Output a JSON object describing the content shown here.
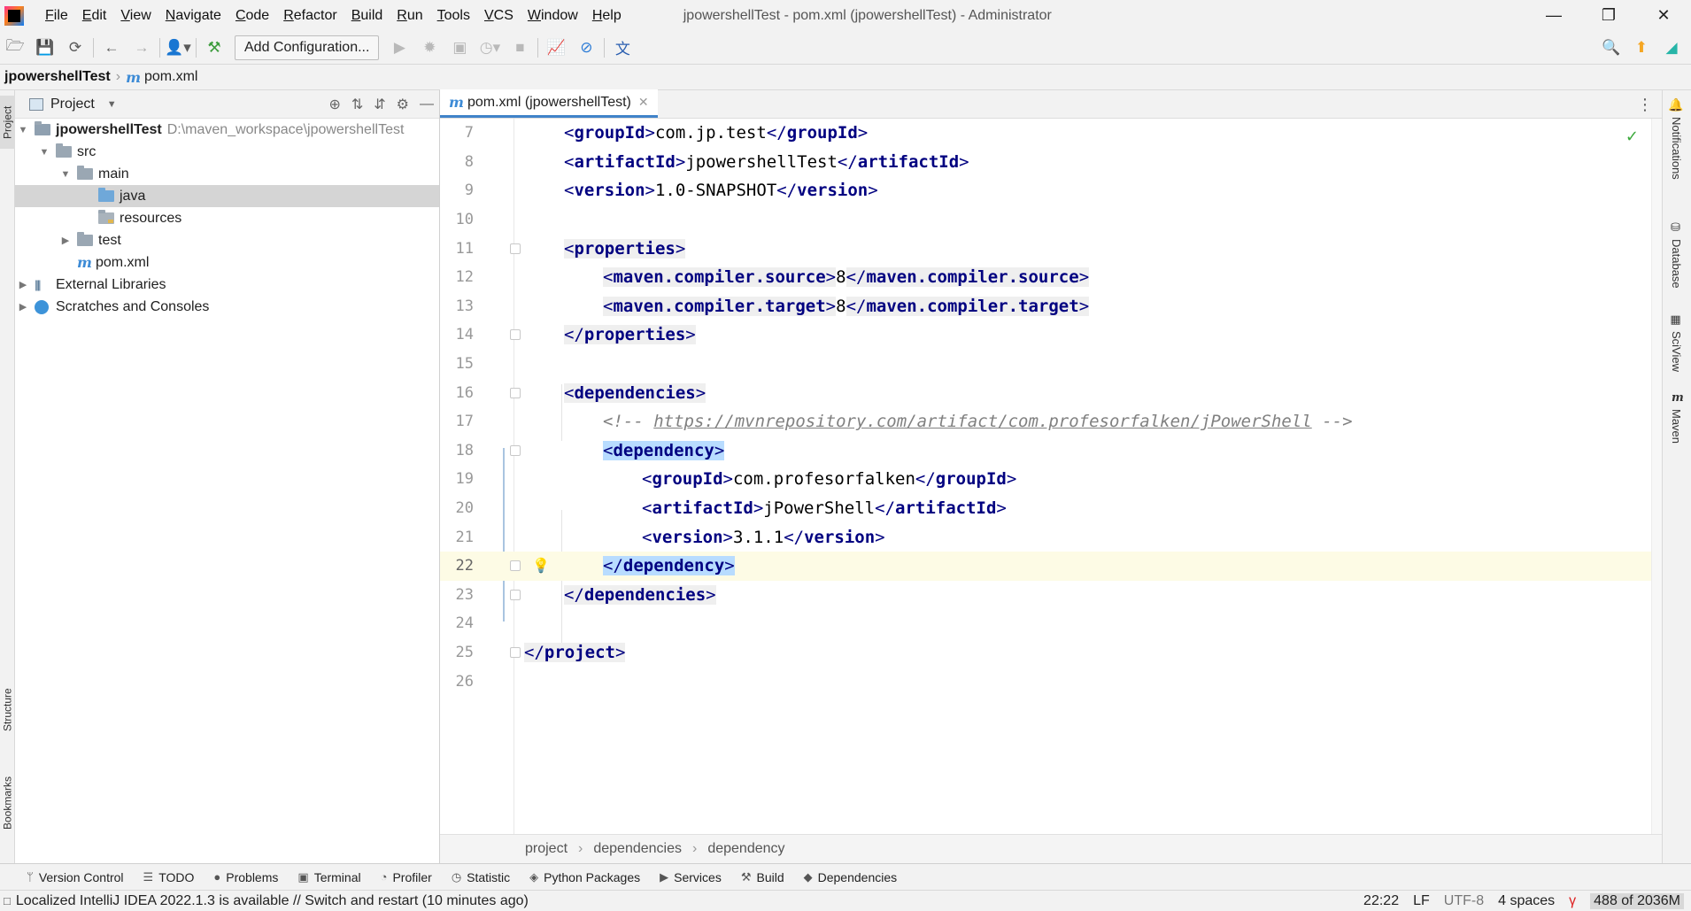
{
  "menu": {
    "items": [
      {
        "underline": "F",
        "rest": "ile"
      },
      {
        "underline": "E",
        "rest": "dit"
      },
      {
        "underline": "V",
        "rest": "iew"
      },
      {
        "underline": "N",
        "rest": "avigate"
      },
      {
        "underline": "C",
        "rest": "ode"
      },
      {
        "underline": "R",
        "rest": "efactor"
      },
      {
        "underline": "B",
        "rest": "uild"
      },
      {
        "underline": "R",
        "rest": "un"
      },
      {
        "underline": "T",
        "rest": "ools"
      },
      {
        "underline": "V",
        "rest": "CS"
      },
      {
        "underline": "W",
        "rest": "indow"
      },
      {
        "underline": "H",
        "rest": "elp"
      }
    ],
    "window_title": "jpowershellTest - pom.xml (jpowershellTest) - Administrator"
  },
  "toolbar": {
    "add_configuration": "Add Configuration..."
  },
  "navbar": {
    "project": "jpowershellTest",
    "file": "pom.xml"
  },
  "left_strip": {
    "project": "Project",
    "structure": "Structure",
    "bookmarks": "Bookmarks"
  },
  "project_panel": {
    "title": "Project",
    "tree": {
      "root_name": "jpowershellTest",
      "root_path": "D:\\maven_workspace\\jpowershellTest",
      "src": "src",
      "main": "main",
      "java": "java",
      "resources": "resources",
      "test": "test",
      "pom": "pom.xml",
      "external_libraries": "External Libraries",
      "scratches": "Scratches and Consoles"
    }
  },
  "editor": {
    "tab_label": "pom.xml (jpowershellTest)",
    "line_numbers": [
      "7",
      "8",
      "9",
      "10",
      "11",
      "12",
      "13",
      "14",
      "15",
      "16",
      "17",
      "18",
      "19",
      "20",
      "21",
      "22",
      "23",
      "24",
      "25",
      "26"
    ],
    "code": {
      "groupId_open": "groupId",
      "groupId_val": "com.jp.test",
      "artifactId_open": "artifactId",
      "artifactId_val": "jpowershellTest",
      "version_open": "version",
      "version_val": "1.0-SNAPSHOT",
      "properties": "properties",
      "src_tag": "maven.compiler.source",
      "src_val": "8",
      "tgt_tag": "maven.compiler.target",
      "tgt_val": "8",
      "dependencies": "dependencies",
      "comment_url": "https://mvnrepository.com/artifact/com.profesorfalken/jPowerShell",
      "dependency": "dependency",
      "dep_group_val": "com.profesorfalken",
      "dep_artifact_val": "jPowerShell",
      "dep_version_val": "3.1.1",
      "project": "project"
    },
    "breadcrumb": [
      "project",
      "dependencies",
      "dependency"
    ]
  },
  "right_strip": {
    "notifications": "Notifications",
    "database": "Database",
    "sciview": "SciView",
    "maven": "Maven"
  },
  "tool_windows": [
    {
      "icon": "version-control-icon",
      "glyph": "ᛘ",
      "label": "Version Control"
    },
    {
      "icon": "todo-icon",
      "glyph": "☰",
      "label": "TODO"
    },
    {
      "icon": "problems-icon",
      "glyph": "●",
      "label": "Problems"
    },
    {
      "icon": "terminal-icon",
      "glyph": "▣",
      "label": "Terminal"
    },
    {
      "icon": "profiler-icon",
      "glyph": "◔",
      "label": "Profiler"
    },
    {
      "icon": "statistic-icon",
      "glyph": "◷",
      "label": "Statistic"
    },
    {
      "icon": "python-packages-icon",
      "glyph": "◈",
      "label": "Python Packages"
    },
    {
      "icon": "services-icon",
      "glyph": "▶",
      "label": "Services"
    },
    {
      "icon": "build-icon",
      "glyph": "⚒",
      "label": "Build"
    },
    {
      "icon": "dependencies-icon",
      "glyph": "◆",
      "label": "Dependencies"
    }
  ],
  "status": {
    "message": "Localized IntelliJ IDEA 2022.1.3 is available // Switch and restart (10 minutes ago)",
    "position": "22:22",
    "line_sep": "LF",
    "encoding": "UTF-8",
    "indent": "4 spaces",
    "memory": "488 of 2036M"
  }
}
